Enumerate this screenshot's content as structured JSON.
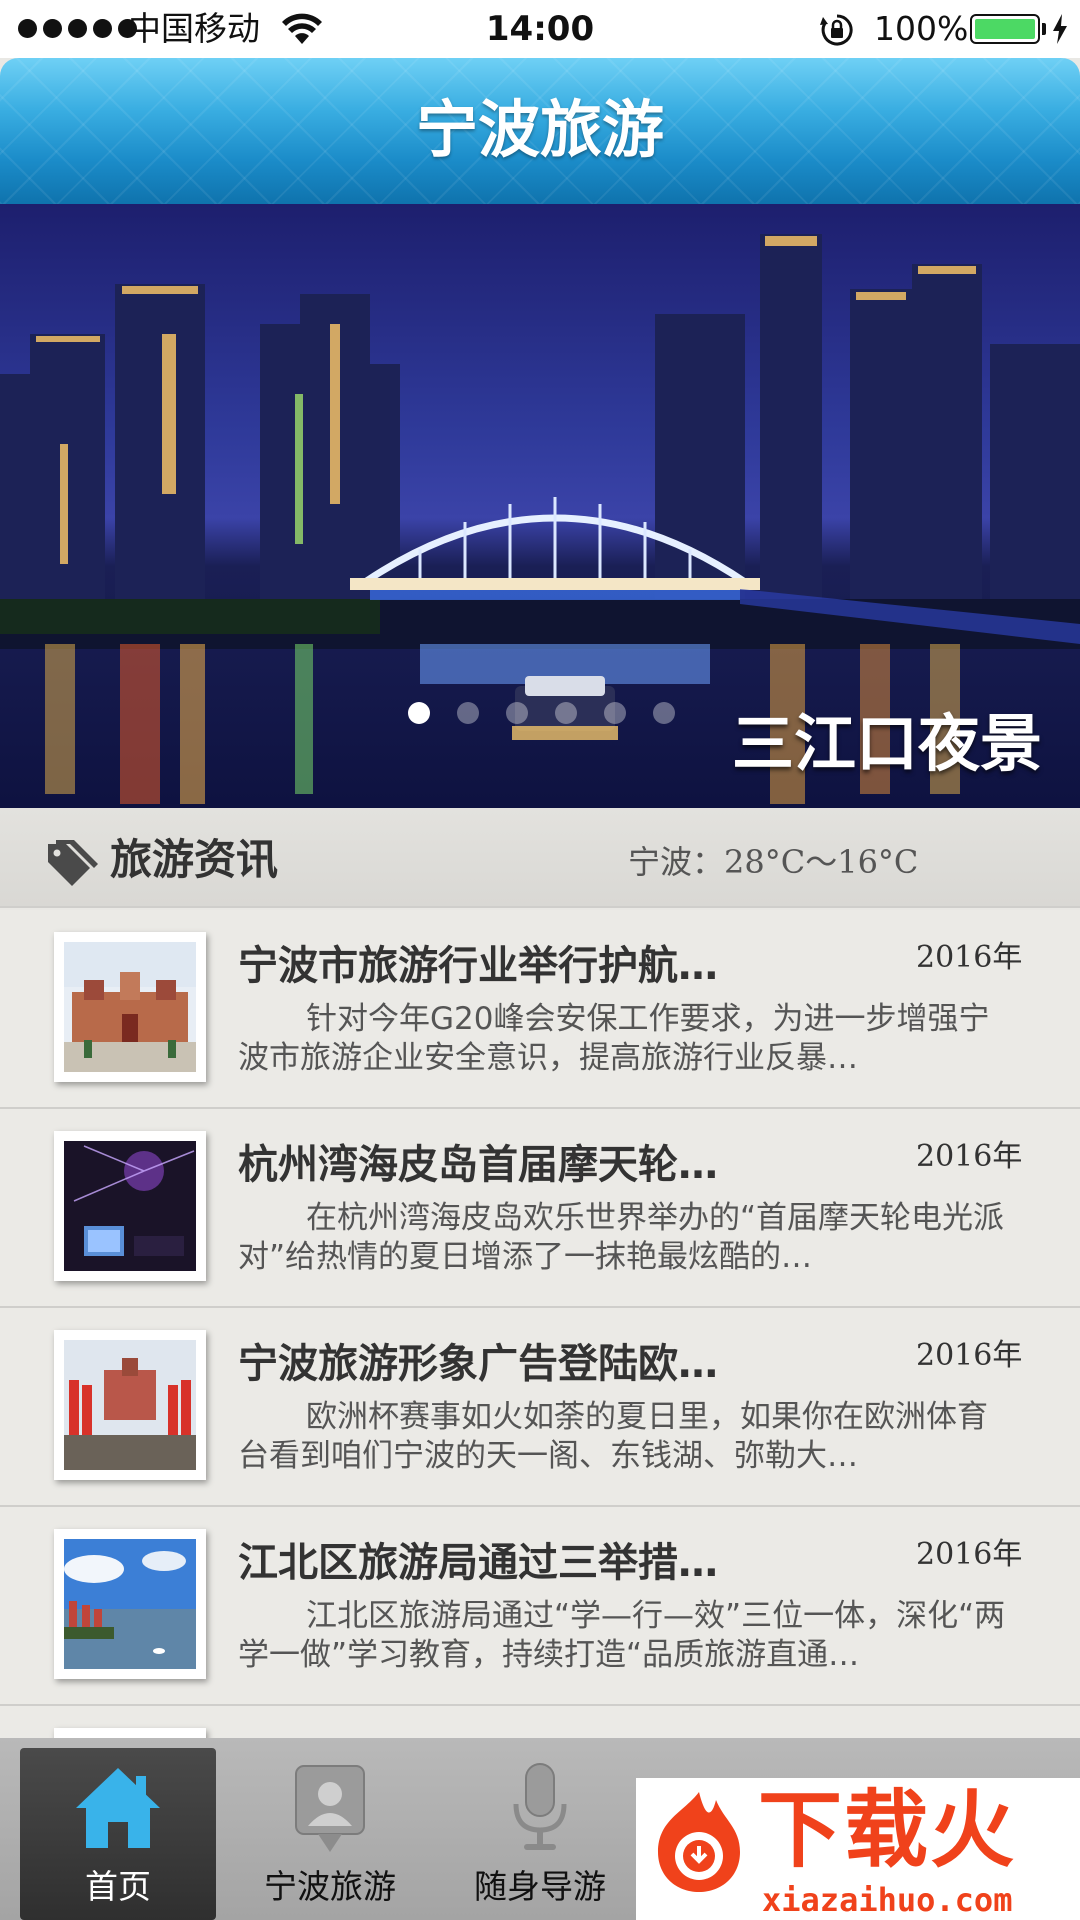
{
  "status_bar": {
    "carrier": "中国移动",
    "time": "14:00",
    "battery_percent": "100%",
    "battery_level": 1.0,
    "battery_color": "#4cd964"
  },
  "header": {
    "title": "宁波旅游",
    "accent_color": "#1b8cc9"
  },
  "banner": {
    "caption": "三江口夜景",
    "slide_count": 6,
    "active_slide": 1
  },
  "section": {
    "icon": "tag-icon",
    "title": "旅游资讯",
    "weather": "宁波：28°C～16°C"
  },
  "news": [
    {
      "title": "宁波市旅游行业举行护航…",
      "date": "2016年",
      "excerpt": "针对今年G20峰会安保工作要求，为进一步增强宁波市旅游企业安全意识，提高旅游行业反暴…"
    },
    {
      "title": "杭州湾海皮岛首届摩天轮…",
      "date": "2016年",
      "excerpt": "在杭州湾海皮岛欢乐世界举办的“首届摩天轮电光派对”给热情的夏日增添了一抹艳最炫酷的…"
    },
    {
      "title": "宁波旅游形象广告登陆欧…",
      "date": "2016年",
      "excerpt": "欧洲杯赛事如火如荼的夏日里，如果你在欧洲体育台看到咱们宁波的天一阁、东钱湖、弥勒大…"
    },
    {
      "title": "江北区旅游局通过三举措…",
      "date": "2016年",
      "excerpt": "江北区旅游局通过“学—行—效”三位一体，深化“两学一做”学习教育，持续打造“品质旅游直通…"
    }
  ],
  "tabs": [
    {
      "label": "首页",
      "icon": "home-icon",
      "active": true
    },
    {
      "label": "宁波旅游",
      "icon": "person-pin-icon",
      "active": false
    },
    {
      "label": "随身导游",
      "icon": "microphone-icon",
      "active": false
    }
  ],
  "watermark": {
    "text": "下载火",
    "url": "xiazaihuo.com",
    "color": "#f0421b"
  }
}
